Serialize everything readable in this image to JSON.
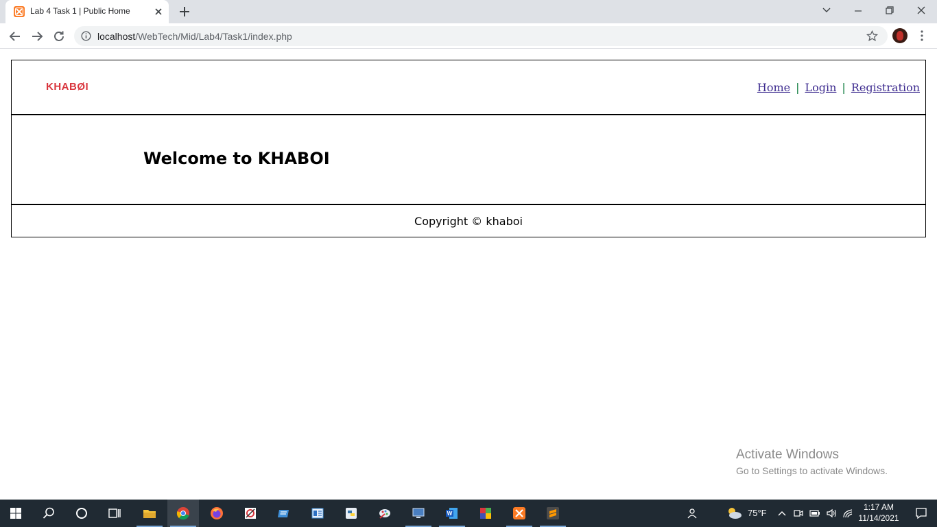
{
  "browser": {
    "tab_title": "Lab 4 Task 1 | Public Home",
    "url_host": "localhost",
    "url_path": "/WebTech/Mid/Lab4/Task1/index.php"
  },
  "site": {
    "logo": "KHABØI",
    "nav": [
      {
        "label": "Home"
      },
      {
        "label": "Login"
      },
      {
        "label": "Registration"
      }
    ],
    "separator": "|",
    "welcome": "Welcome to KHABOI",
    "footer": "Copyright © khaboi"
  },
  "watermark": {
    "title": "Activate Windows",
    "subtitle": "Go to Settings to activate Windows."
  },
  "taskbar": {
    "weather_temp": "75°F",
    "time": "1:17 AM",
    "date": "11/14/2021"
  },
  "colors": {
    "logo": "#d9363e",
    "nav_link": "#3d2b8f",
    "nav_separator": "#0a7a3a",
    "taskbar_bg": "#202a33"
  }
}
